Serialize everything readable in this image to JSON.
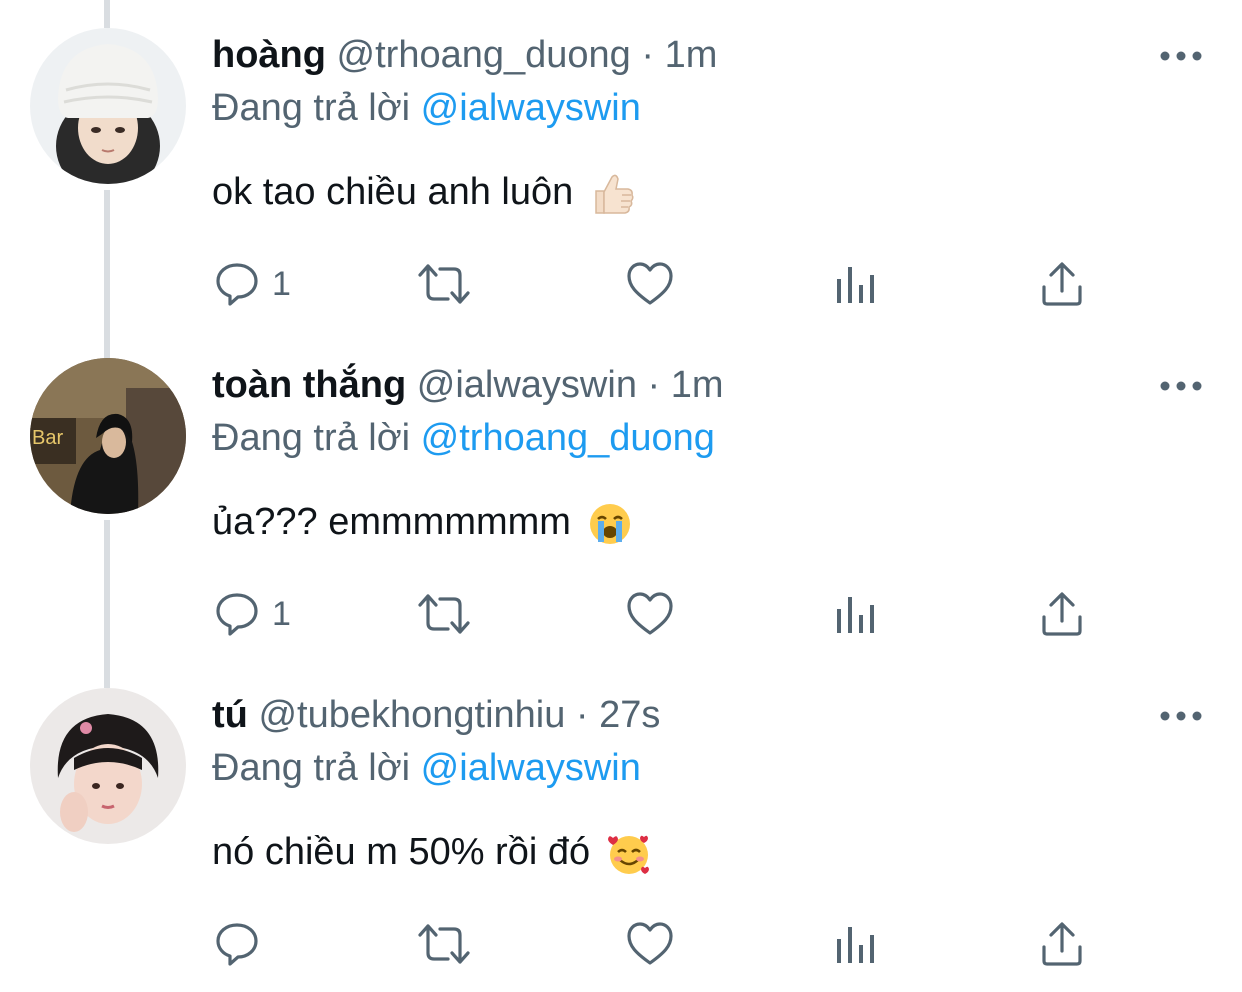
{
  "ui": {
    "reply_prefix": "Đang trả lời",
    "dot": "·",
    "more_label": "more-options",
    "colors": {
      "text": "#0f1419",
      "secondary": "#536471",
      "link": "#1d9bf0",
      "thread_line": "#d9dde1"
    }
  },
  "tweets": [
    {
      "name": "hoàng",
      "handle": "@trhoang_duong",
      "time": "1m",
      "reply_to": "@ialwayswin",
      "text": "ok tao chiều anh luôn",
      "emoji": "thumbs-up",
      "reply_count": "1"
    },
    {
      "name": "toàn thắng",
      "handle": "@ialwayswin",
      "time": "1m",
      "reply_to": "@trhoang_duong",
      "text": "ủa??? emmmmmmm",
      "emoji": "loudly-crying-face",
      "reply_count": "1"
    },
    {
      "name": "tú",
      "handle": "@tubekhongtinhiu",
      "time": "27s",
      "reply_to": "@ialwayswin",
      "text": "nó chiều m 50% rồi đó",
      "emoji": "smiling-face-with-hearts",
      "reply_count": ""
    }
  ]
}
